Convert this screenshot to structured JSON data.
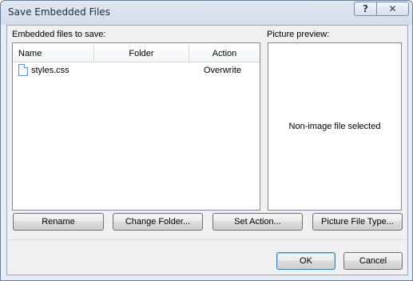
{
  "window": {
    "title": "Save Embedded Files",
    "help_glyph": "?",
    "close_glyph": "✕"
  },
  "files_panel": {
    "label": "Embedded files to save:",
    "columns": {
      "name": "Name",
      "folder": "Folder",
      "action": "Action"
    },
    "rows": [
      {
        "icon": "file-icon",
        "name": "styles.css",
        "folder": "",
        "action": "Overwrite"
      }
    ]
  },
  "preview_panel": {
    "label": "Picture preview:",
    "message": "Non-image file selected"
  },
  "buttons": {
    "rename": "Rename",
    "change_folder": "Change Folder...",
    "set_action": "Set Action...",
    "picture_file_type": "Picture File Type...",
    "ok": "OK",
    "cancel": "Cancel"
  }
}
